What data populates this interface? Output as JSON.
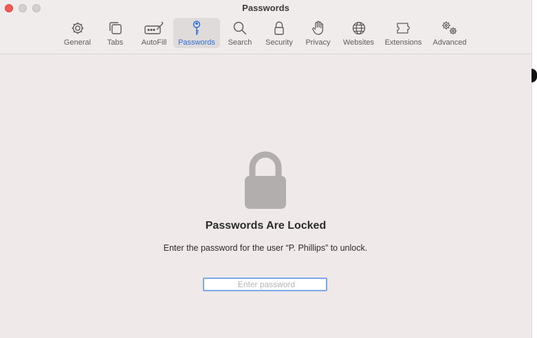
{
  "window": {
    "title": "Passwords"
  },
  "toolbar": {
    "items": [
      {
        "label": "General",
        "icon": "gear-icon"
      },
      {
        "label": "Tabs",
        "icon": "tabs-icon"
      },
      {
        "label": "AutoFill",
        "icon": "autofill-pencil-icon"
      },
      {
        "label": "Passwords",
        "icon": "key-icon",
        "active": true
      },
      {
        "label": "Search",
        "icon": "magnifier-icon"
      },
      {
        "label": "Security",
        "icon": "lock-icon"
      },
      {
        "label": "Privacy",
        "icon": "hand-icon"
      },
      {
        "label": "Websites",
        "icon": "globe-icon"
      },
      {
        "label": "Extensions",
        "icon": "puzzle-icon"
      },
      {
        "label": "Advanced",
        "icon": "gears-icon"
      }
    ]
  },
  "locked": {
    "heading": "Passwords Are Locked",
    "message": "Enter the password for the user “P. Phillips” to unlock.",
    "password_placeholder": "Enter password",
    "password_value": ""
  },
  "colors": {
    "accent": "#2d6fd9",
    "close": "#ee5c55",
    "window_bg": "#efe9e9",
    "lock_gray": "#b3aeae"
  }
}
